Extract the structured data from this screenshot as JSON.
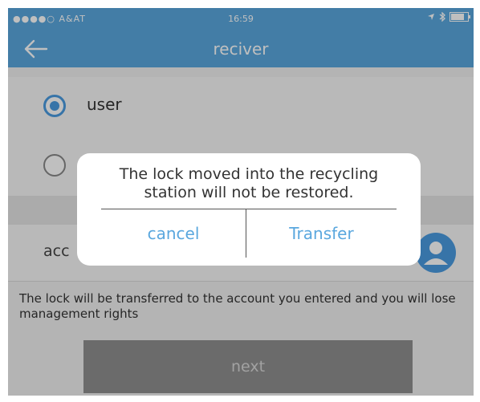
{
  "status_bar": {
    "carrier": "●●●●○ A&AT",
    "time": "16:59"
  },
  "nav": {
    "title": "reciver",
    "back_icon": "arrow-left-icon"
  },
  "options": [
    {
      "label": "user",
      "checked": true
    },
    {
      "label": "",
      "checked": false
    }
  ],
  "account": {
    "label_visible": "acc",
    "icon": "user-avatar-icon"
  },
  "notice": "The lock will be transferred to the account you entered and you will lose management rights",
  "next_label": "next",
  "dialog": {
    "message": "The lock moved into the recycling station will not be restored.",
    "cancel_label": "cancel",
    "transfer_label": "Transfer"
  },
  "colors": {
    "accent": "#5aa7de",
    "button_disabled": "#8f8f8f"
  }
}
